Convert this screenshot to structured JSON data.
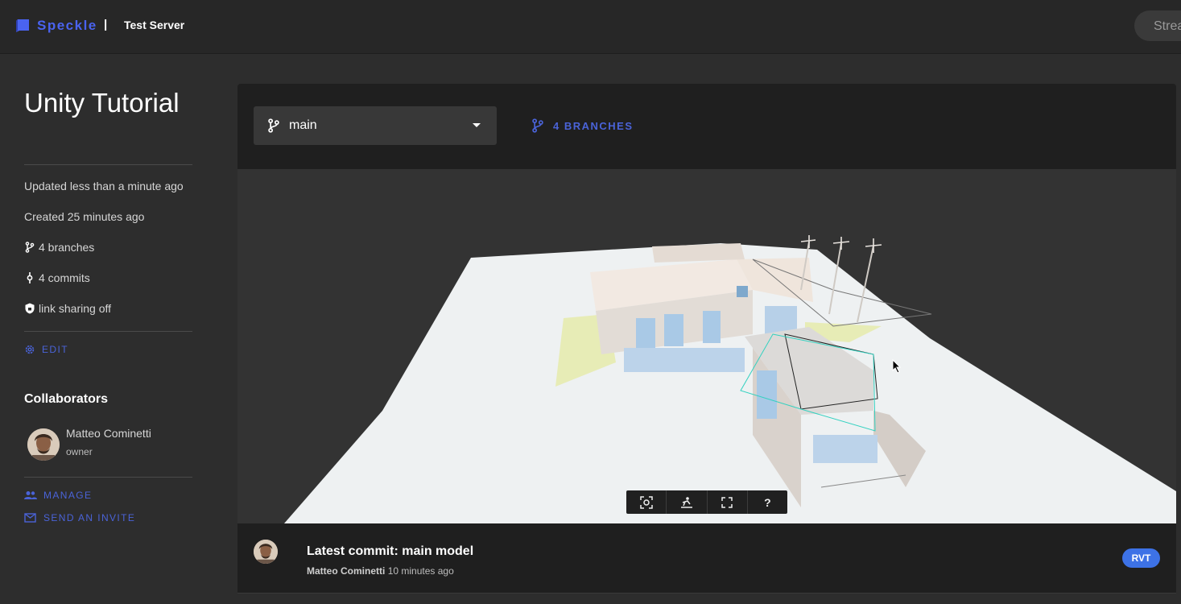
{
  "app": {
    "brand": "Speckle",
    "separator": "|",
    "server_name": "Test Server",
    "search_placeholder": "Strea"
  },
  "stream": {
    "title": "Unity Tutorial",
    "updated": "Updated less than a minute ago",
    "created": "Created 25 minutes ago",
    "branches": "4 branches",
    "commits": "4 commits",
    "link_sharing": "link sharing off",
    "edit_label": "EDIT"
  },
  "collaborators": {
    "heading": "Collaborators",
    "items": [
      {
        "name": "Matteo Cominetti",
        "role": "owner"
      }
    ],
    "manage_label": "MANAGE",
    "invite_label": "SEND AN INVITE"
  },
  "branch_bar": {
    "selected_branch": "main",
    "branches_button": "4 BRANCHES"
  },
  "viewer": {
    "tools": [
      {
        "icon": "zoom-extents-icon",
        "glyph": "⊡"
      },
      {
        "icon": "section-plane-icon",
        "glyph": "⛷"
      },
      {
        "icon": "fullscreen-icon",
        "glyph": "⛶"
      },
      {
        "icon": "help-icon",
        "glyph": "?"
      }
    ]
  },
  "latest_commit": {
    "title": "Latest commit: main model",
    "author": "Matteo Cominetti",
    "time": "10 minutes ago",
    "source_badge": "RVT"
  },
  "colors": {
    "accent": "#4a63d8",
    "brand": "#4a63f0",
    "badge": "#3d72e6",
    "background": "#2d2d2d",
    "card": "#1f1f1f"
  }
}
